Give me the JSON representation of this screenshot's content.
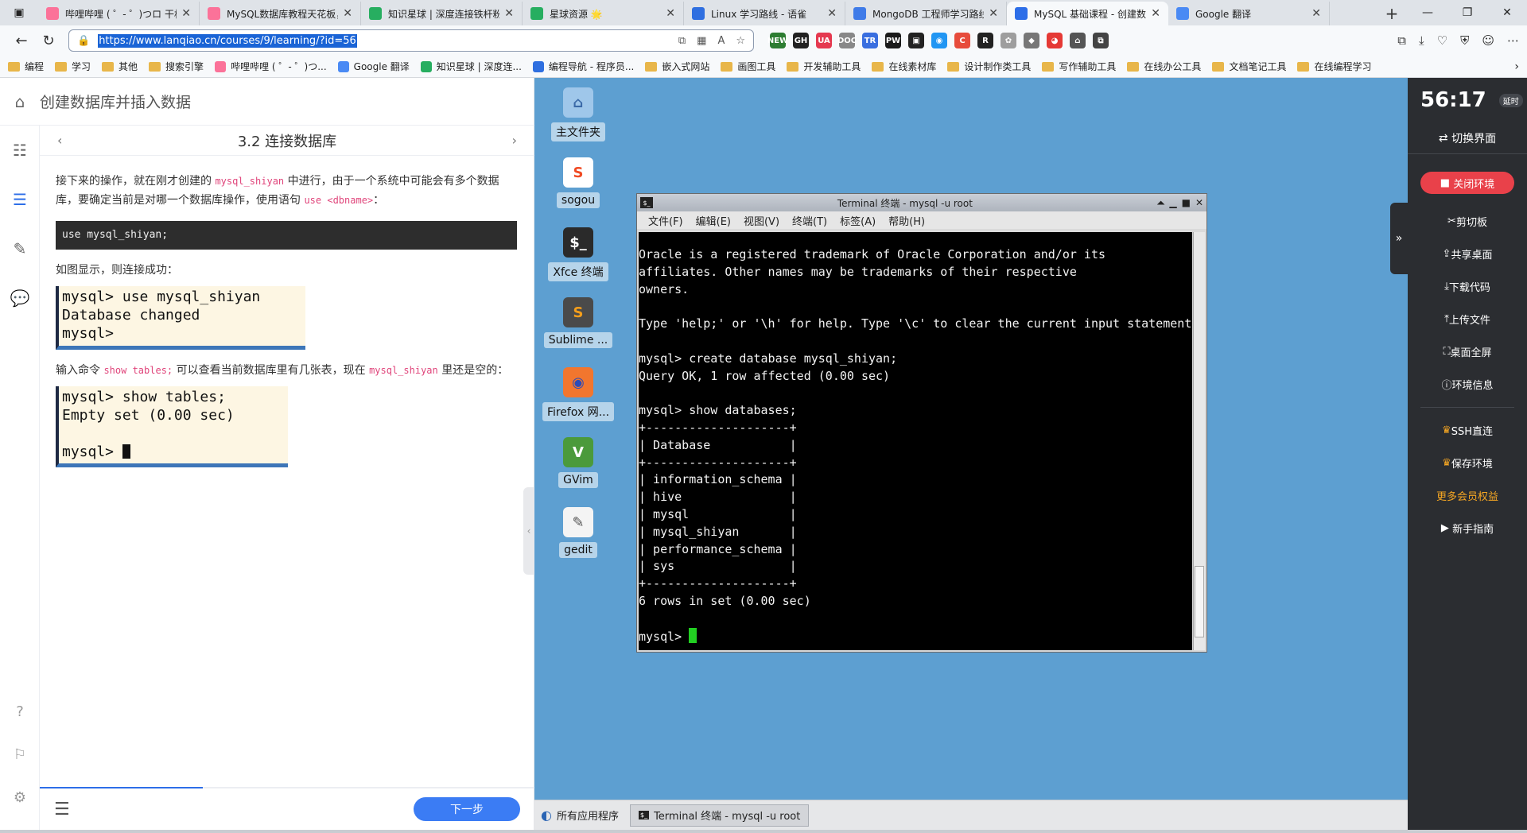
{
  "browser": {
    "tabs": [
      {
        "title": "哔哩哔哩 ( ゜- ゜)つロ 干杯",
        "color": "#fb7299",
        "active": false
      },
      {
        "title": "MySQL数据库教程天花板，",
        "color": "#fb7299",
        "active": false
      },
      {
        "title": "知识星球 | 深度连接铁杆粉",
        "color": "#27ae60",
        "active": false
      },
      {
        "title": "星球资源 🌟",
        "color": "#27ae60",
        "active": false
      },
      {
        "title": "Linux 学习路线 - 语雀",
        "color": "#2f6fe0",
        "active": false
      },
      {
        "title": "MongoDB 工程师学习路线",
        "color": "#3f7be8",
        "active": false
      },
      {
        "title": "MySQL 基础课程 - 创建数据",
        "color": "#2d6ee8",
        "active": true
      },
      {
        "title": "Google 翻译",
        "color": "#4a8af4",
        "active": false
      }
    ],
    "url": "https://www.lanqiao.cn/courses/9/learning/?id=56",
    "extensions": [
      "NEW",
      "GH",
      "UA",
      "DOC",
      "TR",
      "PW",
      "▣",
      "◉",
      "C",
      "R",
      "✿",
      "◆",
      "◕",
      "⌂",
      "⧉"
    ],
    "bookmarks": [
      {
        "label": "编程",
        "type": "folder"
      },
      {
        "label": "学习",
        "type": "folder"
      },
      {
        "label": "其他",
        "type": "folder"
      },
      {
        "label": "搜索引擎",
        "type": "folder"
      },
      {
        "label": "哔哩哔哩 ( ゜- ゜)つ...",
        "type": "site",
        "color": "#fb7299"
      },
      {
        "label": "Google 翻译",
        "type": "site",
        "color": "#4a8af4"
      },
      {
        "label": "知识星球 | 深度连...",
        "type": "site",
        "color": "#27ae60"
      },
      {
        "label": "编程导航 - 程序员...",
        "type": "site",
        "color": "#2f6fe0"
      },
      {
        "label": "嵌入式网站",
        "type": "folder"
      },
      {
        "label": "画图工具",
        "type": "folder"
      },
      {
        "label": "开发辅助工具",
        "type": "folder"
      },
      {
        "label": "在线素材库",
        "type": "folder"
      },
      {
        "label": "设计制作类工具",
        "type": "folder"
      },
      {
        "label": "写作辅助工具",
        "type": "folder"
      },
      {
        "label": "在线办公工具",
        "type": "folder"
      },
      {
        "label": "文档笔记工具",
        "type": "folder"
      },
      {
        "label": "在线编程学习",
        "type": "folder"
      }
    ]
  },
  "course": {
    "breadcrumb": "创建数据库并插入数据",
    "chapter": "3.2 连接数据库",
    "para1_a": "接下来的操作，就在刚才创建的 ",
    "para1_code1": "mysql_shiyan",
    "para1_b": " 中进行，由于一个系统中可能会有多个数据库，要确定当前是对哪一个数据库操作，使用语句 ",
    "para1_code2": "use <dbname>",
    "para1_c": "：",
    "code": "use mysql_shiyan;",
    "para2": "如图显示，则连接成功：",
    "shot1": "mysql> use mysql_shiyan\nDatabase changed\nmysql>",
    "para3_a": "输入命令 ",
    "para3_code1": "show tables;",
    "para3_b": " 可以查看当前数据库里有几张表，现在 ",
    "para3_code2": "mysql_shiyan",
    "para3_c": " 里还是空的：",
    "shot2_lines": [
      "mysql> show tables;",
      "Empty set (0.00 sec)",
      "",
      "mysql> "
    ],
    "next_label": "下一步",
    "progress": 0.33
  },
  "desktop": {
    "icons": [
      {
        "label": "主文件夹",
        "glyph": "⌂",
        "bg": "#9fc7ea",
        "fg": "#3b6aa8"
      },
      {
        "label": "sogou",
        "glyph": "S",
        "bg": "#ffffff",
        "fg": "#f04a23"
      },
      {
        "label": "Xfce 终端",
        "glyph": "$_",
        "bg": "#2a2a2a",
        "fg": "#ffffff"
      },
      {
        "label": "Sublime ...",
        "glyph": "S",
        "bg": "#4a4a4a",
        "fg": "#f59e1b"
      },
      {
        "label": "Firefox 网...",
        "glyph": "◉",
        "bg": "#f2762e",
        "fg": "#2b4bb8"
      },
      {
        "label": "GVim",
        "glyph": "V",
        "bg": "#4b9a3b",
        "fg": "#ffffff"
      },
      {
        "label": "gedit",
        "glyph": "✎",
        "bg": "#f4f4f4",
        "fg": "#555555"
      }
    ],
    "terminal": {
      "title": "Terminal 终端 - mysql -u root",
      "menu": [
        "文件(F)",
        "编辑(E)",
        "视图(V)",
        "终端(T)",
        "标签(A)",
        "帮助(H)"
      ],
      "lines": [
        "Oracle is a registered trademark of Oracle Corporation and/or its",
        "affiliates. Other names may be trademarks of their respective",
        "owners.",
        "",
        "Type 'help;' or '\\h' for help. Type '\\c' to clear the current input statement.",
        "",
        "mysql> create database mysql_shiyan;",
        "Query OK, 1 row affected (0.00 sec)",
        "",
        "mysql> show databases;",
        "+--------------------+",
        "| Database           |",
        "+--------------------+",
        "| information_schema |",
        "| hive               |",
        "| mysql              |",
        "| mysql_shiyan       |",
        "| performance_schema |",
        "| sys                |",
        "+--------------------+",
        "6 rows in set (0.00 sec)",
        "",
        "mysql> "
      ]
    },
    "taskbar": {
      "apps_label": "所有应用程序",
      "task_label": "Terminal 终端 - mysql -u root"
    }
  },
  "side": {
    "timer": "56:17",
    "extend": "延时",
    "switch": "切换界面",
    "close": "关闭环境",
    "items": [
      "剪切板",
      "共享桌面",
      "下载代码",
      "上传文件",
      "桌面全屏",
      "环境信息"
    ],
    "items2": [
      "SSH直连",
      "保存环境"
    ],
    "more": "更多会员权益",
    "guide": "新手指南"
  }
}
